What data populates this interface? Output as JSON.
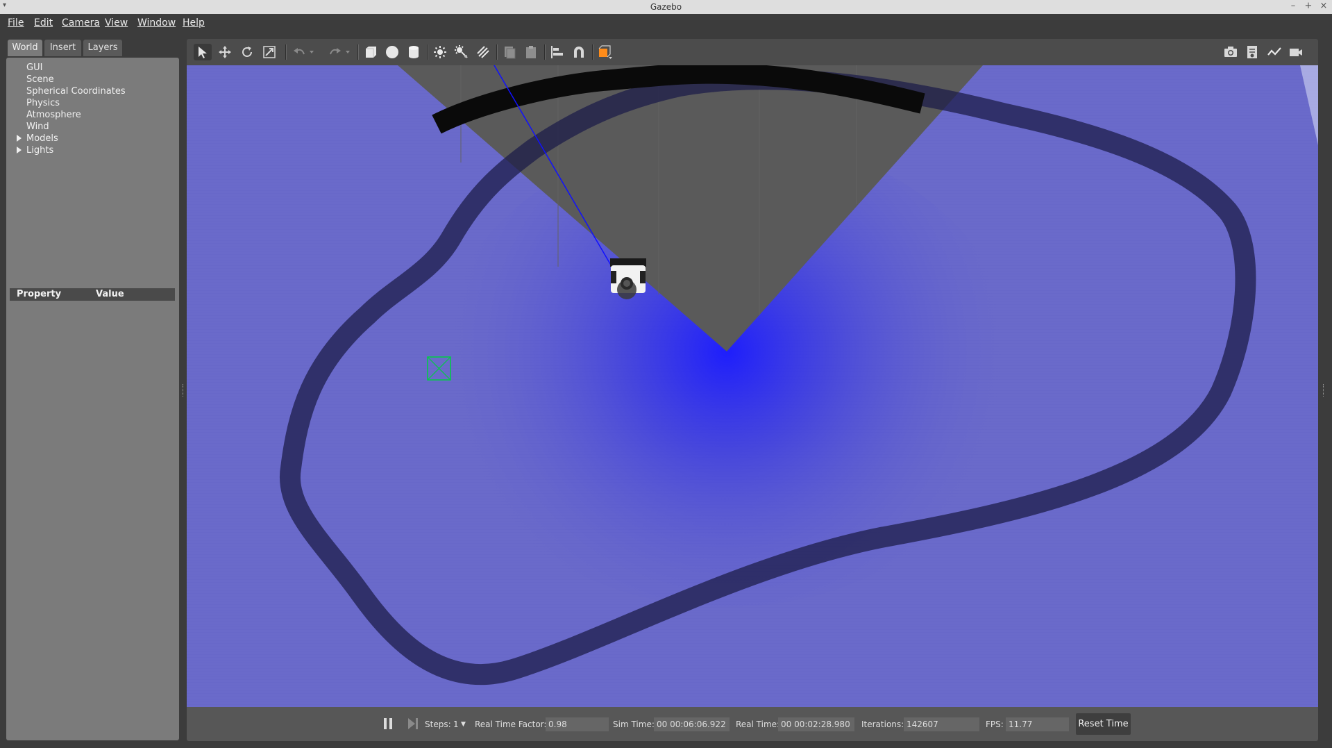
{
  "window": {
    "title": "Gazebo"
  },
  "menu": [
    "File",
    "Edit",
    "Camera",
    "View",
    "Window",
    "Help"
  ],
  "tabs": [
    "World",
    "Insert",
    "Layers"
  ],
  "world_tree": [
    {
      "label": "GUI",
      "expandable": false
    },
    {
      "label": "Scene",
      "expandable": false
    },
    {
      "label": "Spherical Coordinates",
      "expandable": false
    },
    {
      "label": "Physics",
      "expandable": false
    },
    {
      "label": "Atmosphere",
      "expandable": false
    },
    {
      "label": "Wind",
      "expandable": false
    },
    {
      "label": "Models",
      "expandable": true
    },
    {
      "label": "Lights",
      "expandable": true
    }
  ],
  "properties": {
    "col_property": "Property",
    "col_value": "Value"
  },
  "toolbar_left": [
    "select-arrow-icon",
    "translate-icon",
    "rotate-icon",
    "scale-icon",
    "undo-icon",
    "undo-dropdown-icon",
    "redo-icon",
    "redo-dropdown-icon",
    "box-icon",
    "sphere-icon",
    "cylinder-icon",
    "point-light-icon",
    "spot-light-icon",
    "directional-light-icon",
    "copy-icon",
    "paste-icon",
    "align-icon",
    "snap-magnet-icon",
    "view-angle-icon"
  ],
  "toolbar_right": [
    "screenshot-camera-icon",
    "log-record-icon",
    "plot-icon",
    "video-record-icon"
  ],
  "bottom": {
    "steps_label": "Steps:",
    "steps_value": "1",
    "rtf_label": "Real Time Factor:",
    "rtf_value": "0.98",
    "sim_time_label": "Sim Time:",
    "sim_time_value": "00 00:06:06.922",
    "real_time_label": "Real Time:",
    "real_time_value": "00 00:02:28.980",
    "iterations_label": "Iterations:",
    "iterations_value": "142607",
    "fps_label": "FPS:",
    "fps_value": "11.77",
    "reset_label": "Reset Time"
  },
  "colors": {
    "ground": "#6a6aca",
    "laser_center": "#1a1aff",
    "track": "#1e1e4a",
    "camera_fov": "#5a5a5a",
    "toolbar_accent": "#ff8c1a",
    "goal_marker": "#00cc44"
  }
}
